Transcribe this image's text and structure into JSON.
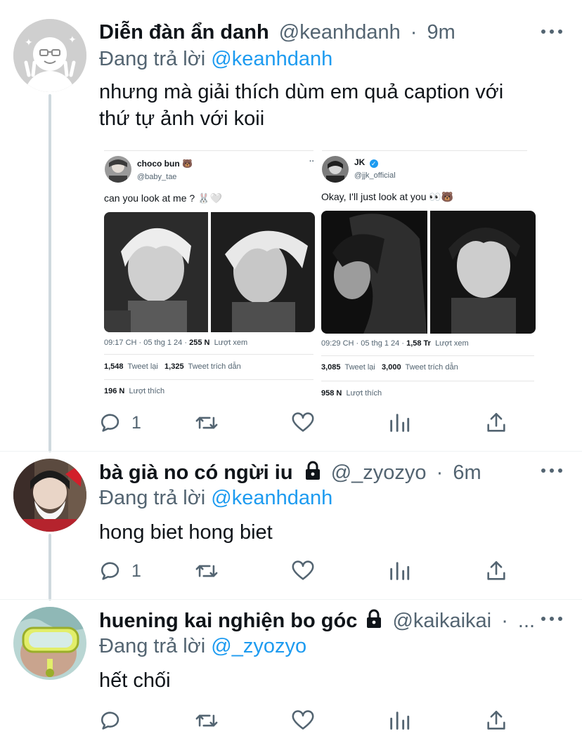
{
  "tweets": [
    {
      "name": "Diễn đàn ẩn danh",
      "handle": "@keanhdanh",
      "dot": "·",
      "time": "9m",
      "replying_prefix": "Đang trả lời",
      "replying_to": "@keanhdanh",
      "text_line1": "nhưng mà giải thích dùm em quả caption với",
      "text_line2": "thứ tự ảnh với koii",
      "reply_count": "1",
      "avatar_icon": "peace-sign-face-avatar"
    },
    {
      "name": "bà già no có ngừi iu",
      "handle": "@_zyozyo",
      "dot": "·",
      "time": "6m",
      "replying_prefix": "Đang trả lời",
      "replying_to": "@keanhdanh",
      "text": "hong biet hong biet",
      "reply_count": "1",
      "protected": true
    },
    {
      "name": "huening kai nghiện bo góc",
      "handle": "@kaikaikai",
      "dot": "·",
      "time": "...",
      "replying_prefix": "Đang trả lời",
      "replying_to": "@_zyozyo",
      "text": "hết chối",
      "reply_count": "",
      "protected": true
    }
  ],
  "embedded": {
    "left": {
      "name": "choco bun 🐻",
      "handle": "@baby_tae",
      "text": "can you look at me ? 🐰🤍",
      "time_line": "09:17 CH · 05 thg 1 24 · ",
      "views": "255 N",
      "views_label": "Lượt xem",
      "retweets": "1,548",
      "retweets_label": "Tweet lại",
      "quotes": "1,325",
      "quotes_label": "Tweet trích dẫn",
      "likes": "196 N",
      "likes_label": "Lượt thích"
    },
    "right": {
      "name": "JK",
      "handle": "@jjk_official",
      "text": "Okay, I'll just look at you 👀🐻",
      "time_line": "09:29 CH · 05 thg 1 24 · ",
      "views": "1,58 Tr",
      "views_label": "Lượt xem",
      "retweets": "3,085",
      "retweets_label": "Tweet lại",
      "quotes": "3,000",
      "quotes_label": "Tweet trích dẫn",
      "likes": "958 N",
      "likes_label": "Lượt thích"
    }
  },
  "colors": {
    "link": "#1d9bf0",
    "secondary": "#536471",
    "primary": "#0f1419",
    "thread_line": "#cfd9de"
  }
}
